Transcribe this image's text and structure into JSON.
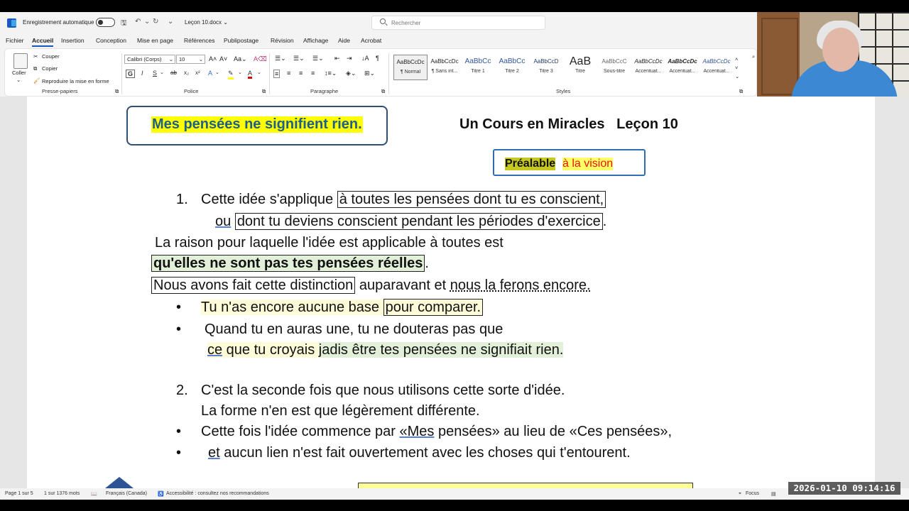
{
  "titlebar": {
    "autosave_label": "Enregistrement automatique",
    "doc_name": "Leçon 10.docx",
    "search_placeholder": "Rechercher"
  },
  "menu": {
    "tabs": [
      "Fichier",
      "Accueil",
      "Insertion",
      "Conception",
      "Mise en page",
      "Références",
      "Publipostage",
      "Révision",
      "Affichage",
      "Aide",
      "Acrobat"
    ],
    "active": "Accueil"
  },
  "ribbon": {
    "clipboard": {
      "paste": "Coller",
      "cut": "Couper",
      "copy": "Copier",
      "format_painter": "Reproduire la mise en forme",
      "label": "Presse-papiers"
    },
    "font": {
      "family": "Calibri (Corps)",
      "size": "10",
      "label": "Police"
    },
    "paragraph": {
      "label": "Paragraphe"
    },
    "styles": {
      "label": "Styles",
      "items": [
        {
          "preview": "AaBbCcDc",
          "name": "¶ Normal"
        },
        {
          "preview": "AaBbCcDc",
          "name": "¶ Sans int..."
        },
        {
          "preview": "AaBbCc",
          "name": "Titre 1"
        },
        {
          "preview": "AaBbCc",
          "name": "Titre 2"
        },
        {
          "preview": "AaBbCcD",
          "name": "Titre 3"
        },
        {
          "preview": "AaB",
          "name": "Titre"
        },
        {
          "preview": "AaBbCcC",
          "name": "Sous-titre"
        },
        {
          "preview": "AaBbCcDc",
          "name": "Accentuat..."
        },
        {
          "preview": "AaBbCcDc",
          "name": "Accentuat..."
        },
        {
          "preview": "AaBbCcDc",
          "name": "Accentuat..."
        }
      ]
    }
  },
  "document": {
    "title_box": "Mes pensées ne signifient rien.",
    "course_title": "Un Cours en Miracles   Leçon 10",
    "pre_a": "Préalable",
    "pre_b": " à la vision",
    "l1_num": "1.",
    "l1_a": "Cette idée s'applique ",
    "l1_b": "à toutes les pensées dont tu es conscient,",
    "l2_a": "ou",
    "l2_b": "dont tu deviens conscient pendant les périodes d'exercice",
    "l2_c": ".",
    "l3": "La raison pour laquelle l'idée est applicable à toutes est",
    "l4_a": "qu'elles ne sont pas tes pensées réelles",
    "l4_b": ".",
    "l5_a": "Nous avons fait cette distinction",
    "l5_b": " auparavant et ",
    "l5_c": "nous la ferons encore.",
    "b1_a": "Tu n'as encore aucune base ",
    "b1_b": "pour comparer.",
    "b2": "Quand tu en auras une, tu ne douteras pas que",
    "l6_a": "ce",
    "l6_b": " que tu croyais ",
    "l6_c": "jadis être tes pensées ne signifiait rien.",
    "l7_num": "2.",
    "l7": "C'est la seconde fois que nous utilisons cette sorte d'idée.",
    "l8": "La forme n'en est que légèrement différente.",
    "b3_a": "Cette fois l'idée commence par ",
    "b3_b": "«Mes",
    "b3_c": " pensées» au lieu de «Ces pensées»,",
    "b4_a": "et",
    "b4_b": " aucun lien n'est fait ouvertement avec les choses qui t'entourent.",
    "bullet": "•"
  },
  "status": {
    "page": "Page 1 sur 5",
    "words": "1 sur 1376 mots",
    "language": "Français (Canada)",
    "accessibility": "Accessibilité : consultez nos recommandations",
    "focus": "Focus"
  },
  "overlay": {
    "timestamp": "2026-01-10 09:14:16"
  },
  "colors": {
    "accent": "#185abd",
    "highlight_yellow": "#ffff00",
    "title_blue": "#1f5e8a"
  }
}
